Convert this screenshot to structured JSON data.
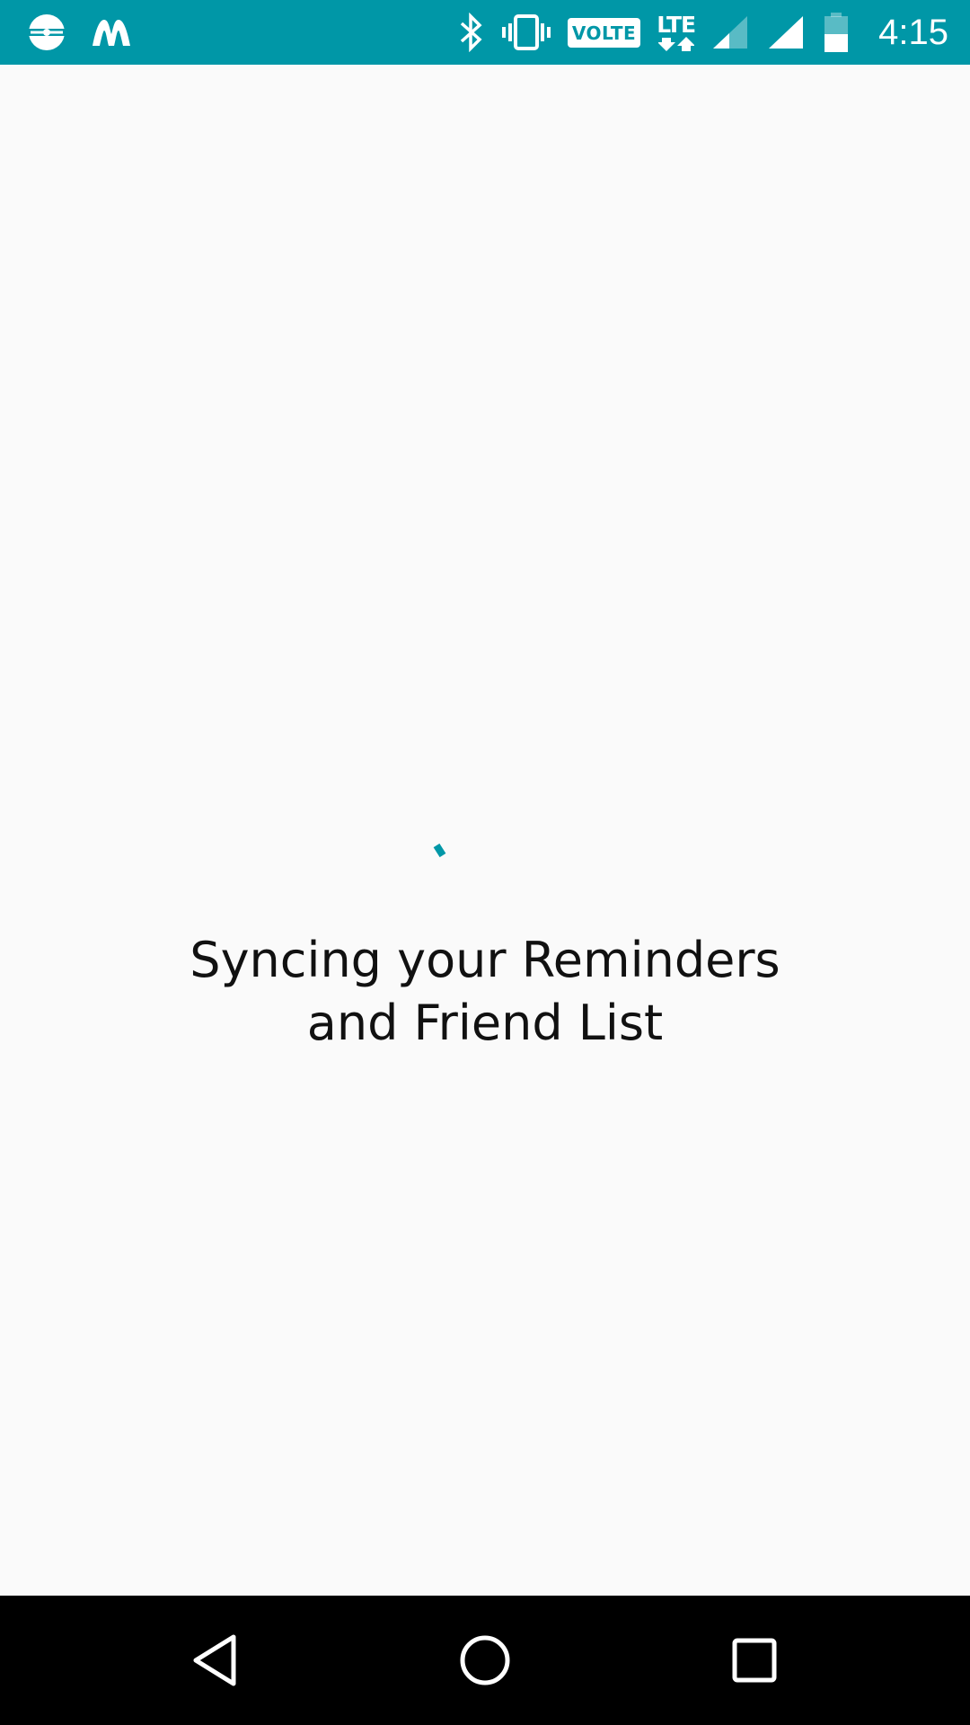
{
  "status_bar": {
    "background_color": "#0097a7",
    "left_icons": [
      "hotspot-app-icon",
      "moto-app-icon"
    ],
    "right_icons": [
      "bluetooth-icon",
      "vibrate-icon",
      "volte-icon",
      "lte-icon",
      "signal-icon",
      "signal-icon",
      "battery-icon"
    ],
    "volte_label": "VOLTE",
    "network_label": "LTE",
    "time": "4:15"
  },
  "main": {
    "spinner_color": "#0097a7",
    "message": "Syncing your Reminders\nand Friend List"
  },
  "nav_bar": {
    "buttons": [
      "back-icon",
      "home-icon",
      "recents-icon"
    ]
  }
}
